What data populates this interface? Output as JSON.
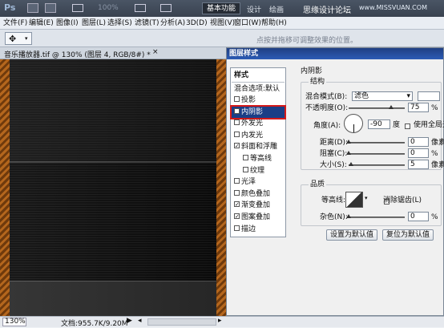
{
  "topbar": {
    "ps_logo": "Ps",
    "zoom": "100%",
    "workspace": "基本功能",
    "design": "设计",
    "paint": "绘画",
    "watermark": "思缘设计论坛",
    "site": "www.MISSVUAN.COM"
  },
  "menu": [
    "文件(F)",
    "编辑(E)",
    "图像(I)",
    "图层(L)",
    "选择(S)",
    "滤镜(T)",
    "分析(A)",
    "3D(D)",
    "视图(V)",
    "窗口(W)",
    "帮助(H)"
  ],
  "options": {
    "hint": "点按并拖移可调整效果的位置。"
  },
  "doc": {
    "tab": "音乐播放器.tif @ 130% (图层 4, RGB/8#) *",
    "zoom": "130%",
    "docsize": "文档:955.7K/9.20M"
  },
  "dialog": {
    "title": "图层样式",
    "styles_header": "样式",
    "blend_options": "混合选项:默认",
    "effects": [
      {
        "label": "投影",
        "checked": false,
        "indent": false,
        "selected": false
      },
      {
        "label": "内阴影",
        "checked": true,
        "indent": false,
        "selected": true
      },
      {
        "label": "外发光",
        "checked": false,
        "indent": false,
        "selected": false
      },
      {
        "label": "内发光",
        "checked": false,
        "indent": false,
        "selected": false
      },
      {
        "label": "斜面和浮雕",
        "checked": true,
        "indent": false,
        "selected": false
      },
      {
        "label": "等高线",
        "checked": false,
        "indent": true,
        "selected": false
      },
      {
        "label": "纹理",
        "checked": false,
        "indent": true,
        "selected": false
      },
      {
        "label": "光泽",
        "checked": false,
        "indent": false,
        "selected": false
      },
      {
        "label": "颜色叠加",
        "checked": false,
        "indent": false,
        "selected": false
      },
      {
        "label": "渐变叠加",
        "checked": true,
        "indent": false,
        "selected": false
      },
      {
        "label": "图案叠加",
        "checked": true,
        "indent": false,
        "selected": false
      },
      {
        "label": "描边",
        "checked": false,
        "indent": false,
        "selected": false
      }
    ],
    "section": "内阴影",
    "structure": "结构",
    "blend_mode_label": "混合模式(B):",
    "blend_mode": "滤色",
    "opacity_label": "不透明度(O):",
    "opacity": "75",
    "opacity_unit": "%",
    "opacity_fraction": 0.75,
    "angle_label": "角度(A):",
    "angle": "-90",
    "angle_unit": "度",
    "global_light": "使用全局光",
    "distance_label": "距离(D):",
    "distance": "0",
    "size_unit": "像素",
    "distance_fraction": 0.0,
    "choke_label": "阻塞(C):",
    "choke": "0",
    "choke_unit": "%",
    "choke_fraction": 0.0,
    "size_label": "大小(S):",
    "size": "5",
    "size_fraction": 0.04,
    "quality": "品质",
    "contour_label": "等高线:",
    "antialias": "消除锯齿(L)",
    "noise_label": "杂色(N):",
    "noise": "0",
    "noise_unit": "%",
    "noise_fraction": 0.0,
    "btn_default": "设置为默认值",
    "btn_reset": "复位为默认值"
  }
}
